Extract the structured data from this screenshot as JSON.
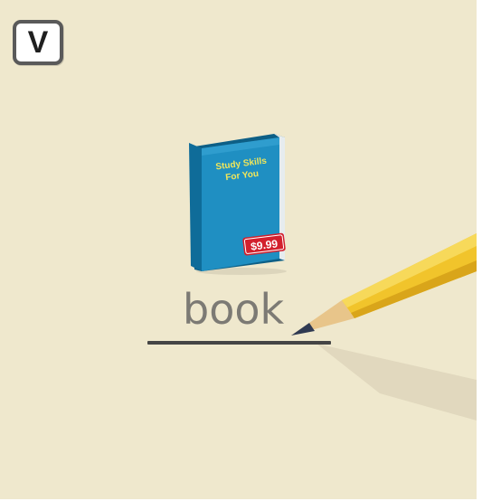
{
  "badge": {
    "letter": "V"
  },
  "book": {
    "title_line1": "Study Skills",
    "title_line2": "For You",
    "price": "$9.99",
    "colors": {
      "cover": "#1f8fc2",
      "spine": "#0f6c99",
      "title": "#f2e75a",
      "price_tag": "#d3202d"
    }
  },
  "word": {
    "text": "book"
  },
  "colors": {
    "background": "#efe8cd",
    "pencil_body": "#f1c42b",
    "pencil_tip": "#2f3a52",
    "underline": "#454545"
  },
  "icons": {
    "book": "book-icon",
    "pencil": "pencil-icon"
  }
}
